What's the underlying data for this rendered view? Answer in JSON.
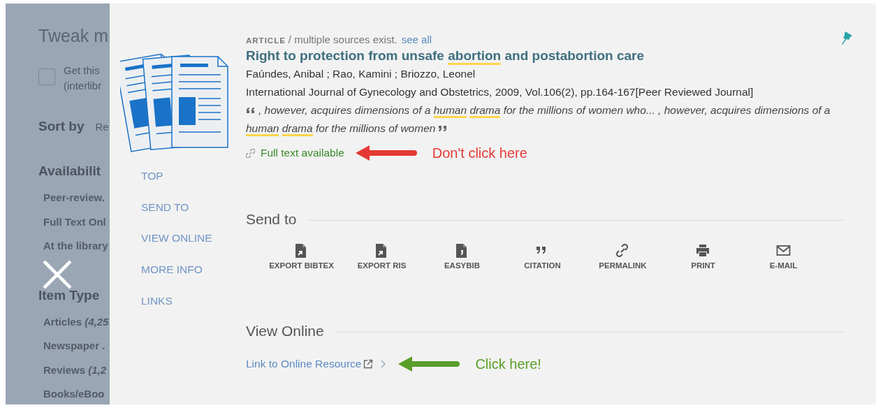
{
  "backdrop": {
    "heading": "Tweak m",
    "checkbox": {
      "label_lines": [
        "Get this",
        "(interlibr"
      ],
      "checked": false
    },
    "sort_label": "Sort by",
    "sort_value": "Re",
    "sections": [
      {
        "title": "Availabilit",
        "items": [
          "Peer-review.",
          "Full Text Onl",
          "At the library"
        ]
      },
      {
        "title": "Item Type",
        "items": [
          "Articles *(4,25*",
          "Newspaper .",
          "Reviews *(1,2*",
          "Books/eBoo"
        ]
      }
    ]
  },
  "panel": {
    "nav": [
      "TOP",
      "SEND TO",
      "VIEW ONLINE",
      "MORE INFO",
      "LINKS"
    ],
    "record": {
      "type": "ARTICLE",
      "type_note": "/ multiple sources exist.",
      "see_all": "see all",
      "title": [
        {
          "text": "Right to protection from unsafe ",
          "highlight": false
        },
        {
          "text": "abortion",
          "highlight": true
        },
        {
          "text": " and postabortion care",
          "highlight": false
        }
      ],
      "authors": "Faúndes, Anibal ; Rao, Kamini ; Briozzo, Leonel",
      "source": "International Journal of Gynecology and Obstetrics, 2009, Vol.106(2), pp.164-167[Peer Reviewed Journal]",
      "snippet": [
        {
          "text": ", however, acquires dimensions of a ",
          "highlight": false
        },
        {
          "text": "human drama",
          "highlight": true
        },
        {
          "text": " for the millions of women who... , however, acquires dimensions of a ",
          "highlight": false
        },
        {
          "text": "human drama",
          "highlight": true
        },
        {
          "text": " for the millions of women",
          "highlight": false
        }
      ],
      "availability": "Full text available"
    },
    "send_to": {
      "heading": "Send to",
      "actions": [
        {
          "label": "EXPORT BIBTEX",
          "kind": "export"
        },
        {
          "label": "EXPORT RIS",
          "kind": "export"
        },
        {
          "label": "EASYBIB",
          "kind": "easybib"
        },
        {
          "label": "CITATION",
          "kind": "citation"
        },
        {
          "label": "PERMALINK",
          "kind": "permalink"
        },
        {
          "label": "PRINT",
          "kind": "print"
        },
        {
          "label": "E-MAIL",
          "kind": "email"
        }
      ]
    },
    "view_online": {
      "heading": "View Online",
      "link": "Link to Online Resource"
    }
  },
  "annotations": [
    {
      "text": "Don't click here",
      "color": "#e53935"
    },
    {
      "text": "Click here!",
      "color": "#5a9e2a"
    }
  ]
}
